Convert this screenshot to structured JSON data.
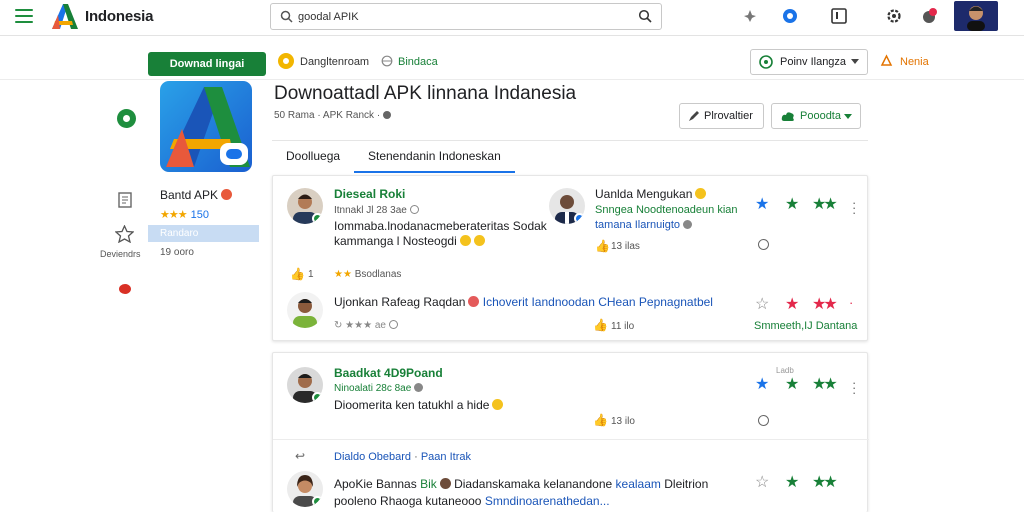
{
  "header": {
    "brand": "Indonesia",
    "search_value": "goodal APIK"
  },
  "subbar": {
    "download_button": "Downad lingai",
    "item_one": "Dangltenroam",
    "item_two": "Bindaca",
    "region_button": "Poinv Ilangza",
    "help_link": "Nenia"
  },
  "app": {
    "name": "Bantd APK",
    "rating_stars": "★★★",
    "rating_value": "150",
    "selected_label": "Randaro",
    "size_label": "19 ooro"
  },
  "rail": {
    "label": "Deviendrs"
  },
  "page": {
    "title": "Downoattadl APK linnana Indanesia",
    "meta": "50 Rama  ·  APK  Ranck  ·",
    "provider_button": "Plrovaltier",
    "share_button": "Pooodta"
  },
  "tabs": [
    {
      "label": "Doolluega"
    },
    {
      "label": "Stenendanin Indoneskan"
    }
  ],
  "reviews": {
    "r1": {
      "name": "Dieseal Roki",
      "sub": "Itnnakl Jl 28 3ae",
      "text1": "Iommaba.lnodanacmeberateritas Sodak",
      "text2": "kammanga l Nosteogdi"
    },
    "r2": {
      "name": "Uanlda Mengukan",
      "sub": "Snngea Noodtenoadeun kian",
      "sub2": "tamana Ilarnuigto",
      "count": "13 ilas"
    },
    "r1_footer": {
      "likes": "1",
      "tag": "Bsodlanas"
    },
    "r3": {
      "name": "Ujonkan Rafeag Raqdan",
      "text": "Ichoverit Iandnoodan CHean Pepnagnatbel",
      "meta": "↻ ★★★ ae",
      "count": "11 ilo",
      "footer": "Smmeeth,IJ Dantana"
    },
    "r4": {
      "name": "Baadkat 4D9Poand",
      "sub": "Ninoalati 28c 8ae",
      "text": "Dioomerita ken tatukhl a hide",
      "count": "13 ilo",
      "tag": "Ladb"
    },
    "r5_head": {
      "left": "Dialdo Obebard",
      "right": "Paan Itrak"
    },
    "r5": {
      "name": "ApoKie Bannas",
      "badge_text": "Bik",
      "text1": "Diadanskamaka kelanandone",
      "text1b": "kealaam",
      "text1c": "Dleitrion",
      "text2": "pooleno Rhaoga kutaneooo",
      "text2b": "Smndinoarenathedan..."
    }
  },
  "colors": {
    "green": "#188038",
    "blue": "#1a73e8",
    "red_star": "#e3284b",
    "orange": "#f2a600"
  },
  "icons": [
    "menu-icon",
    "search-icon",
    "bell-icon",
    "user-icon",
    "settings-icon",
    "star-icon",
    "thumb-up-icon",
    "more-icon",
    "share-icon"
  ]
}
